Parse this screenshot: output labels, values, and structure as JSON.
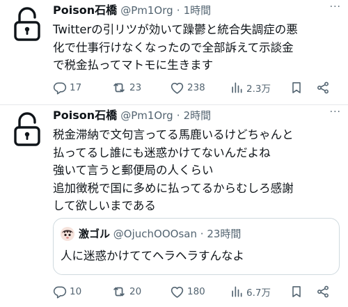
{
  "tweets": [
    {
      "name": "Poison石橋",
      "handle": "@Pm1Org",
      "time": "1時間",
      "lines": [
        "Twitterの引リツが効いて躁鬱と統合失調症の悪",
        "化で仕事行けなくなったので全部訴えて示談金",
        "で税金払ってマトモに生きます"
      ],
      "stats": {
        "replies": "17",
        "retweets": "23",
        "likes": "238",
        "views": "2.3万"
      }
    },
    {
      "name": "Poison石橋",
      "handle": "@Pm1Org",
      "time": "2時間",
      "lines": [
        "税金滞納で文句言ってる馬鹿いるけどちゃんと",
        "払ってるし誰にも迷惑かけてないんだよね",
        "強いて言うと郵便局の人くらい",
        "追加徴税で国に多めに払ってるからむしろ感謝",
        "して欲しいまである"
      ],
      "quote": {
        "name": "激ゴル",
        "handle": "@OjuchOOOsan",
        "time": "23時間",
        "text": "人に迷惑かけててヘラヘラすんなよ"
      },
      "stats": {
        "replies": "10",
        "retweets": "20",
        "likes": "180",
        "views": "6.7万"
      }
    }
  ],
  "separator": "·",
  "more_label": "···",
  "colors": {
    "text": "#0f1419",
    "secondary": "#536471",
    "border": "#cfd9de"
  },
  "icons": [
    "lock-icon",
    "reply-icon",
    "retweet-icon",
    "like-icon",
    "views-icon",
    "bookmark-icon",
    "share-icon",
    "more-icon"
  ]
}
